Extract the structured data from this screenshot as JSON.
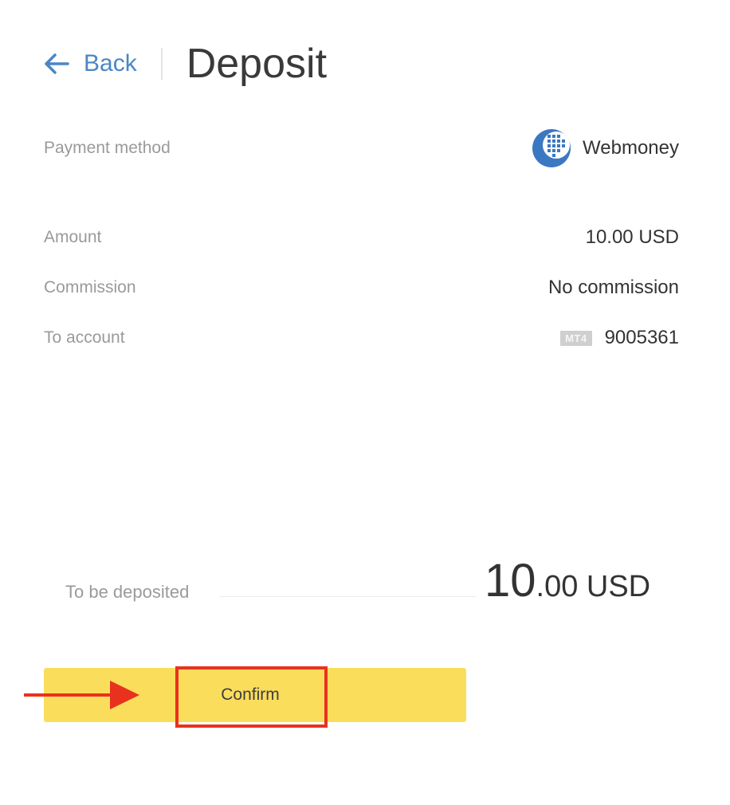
{
  "header": {
    "back_label": "Back",
    "title": "Deposit"
  },
  "details": {
    "payment_method": {
      "label": "Payment method",
      "value": "Webmoney",
      "icon": "webmoney-logo-icon"
    },
    "amount": {
      "label": "Amount",
      "value": "10.00 USD"
    },
    "commission": {
      "label": "Commission",
      "value": "No commission"
    },
    "to_account": {
      "label": "To account",
      "badge": "MT4",
      "value": "9005361"
    }
  },
  "summary": {
    "label": "To be deposited",
    "amount_integer": "10",
    "amount_rest": ".00 USD"
  },
  "confirm": {
    "label": "Confirm"
  },
  "colors": {
    "accent_blue": "#4a86c5",
    "button_yellow": "#fbdd5c",
    "highlight_red": "#e8321e"
  }
}
